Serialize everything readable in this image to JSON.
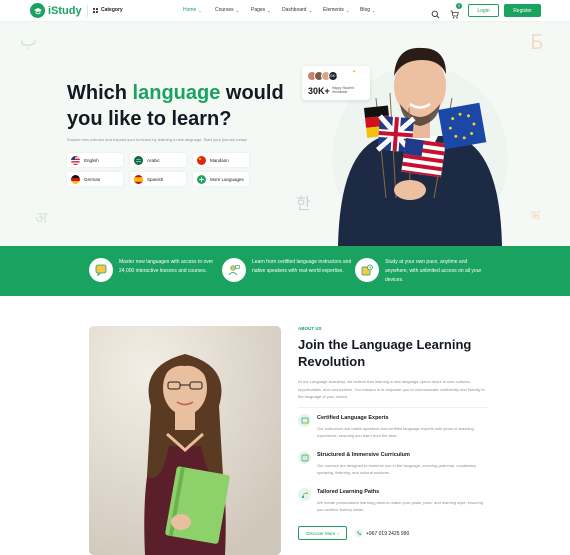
{
  "header": {
    "logo_text": "iStudy",
    "category_label": "Category",
    "nav": [
      {
        "label": "Home",
        "active": true
      },
      {
        "label": "Courses",
        "active": false
      },
      {
        "label": "Pages",
        "active": false
      },
      {
        "label": "Dashboard",
        "active": false
      },
      {
        "label": "Elements",
        "active": false
      },
      {
        "label": "Blog",
        "active": false
      }
    ],
    "cart_count": "0",
    "login_label": "Login",
    "register_label": "Register"
  },
  "hero": {
    "title_part1": "Which ",
    "title_highlight": "language",
    "title_part2": " would you like to learn?",
    "subtitle": "Explore new cultures and expand your horizons by learning a new language. Start your journey today!",
    "languages": [
      {
        "label": "English",
        "flag": "us"
      },
      {
        "label": "Arabic",
        "flag": "sa"
      },
      {
        "label": "Mandarin",
        "flag": "cn"
      },
      {
        "label": "German",
        "flag": "de"
      },
      {
        "label": "Spanish",
        "flag": "es"
      },
      {
        "label": "More Languages",
        "flag": "more"
      }
    ],
    "students_card": {
      "count": "30K+",
      "label": "Happy Student Worldwide",
      "avatar_badge": "20K+"
    },
    "glyphs": [
      "ب",
      "Б",
      "अ",
      "한",
      "ऋ"
    ]
  },
  "features": [
    {
      "text": "Master new languages with access to over 24,000 interactive lessons and courses.",
      "icon": "chat-bubble-icon"
    },
    {
      "text": "Learn from certified language instructors and native speakers with real-world expertise.",
      "icon": "teacher-icon"
    },
    {
      "text": "Study at your own pace, anytime and anywhere, with unlimited access on all your devices.",
      "icon": "clock-book-icon"
    }
  ],
  "about": {
    "tag": "ABOUT US",
    "title": "Join the Language Learning Revolution",
    "description": "At our Language Academy, we believe that learning a new language opens doors to new cultures, opportunities, and connections. Our mission is to empower you to communicate confidently and fluently in the language of your choice.",
    "points": [
      {
        "title": "Certified Language Experts",
        "desc": "Our instructors are native speakers and certified language experts with years of teaching experience, ensuring you learn from the best."
      },
      {
        "title": "Structured & Immersive Curriculum",
        "desc": "Our courses are designed to immerse you in the language, covering grammar, vocabulary, speaking, listening, and cultural nuances."
      },
      {
        "title": "Tailored Learning Paths",
        "desc": "We create personalized learning plans to match your goals, pace, and learning style, ensuring you achieve fluency faster."
      }
    ],
    "discover_label": "Discover More",
    "phone": "+967 019 2425 990"
  },
  "colors": {
    "brand": "#1aa260",
    "dark": "#141a22"
  }
}
